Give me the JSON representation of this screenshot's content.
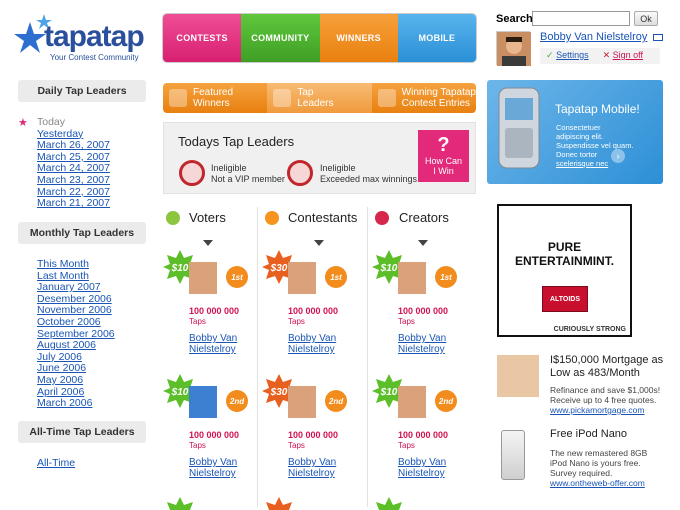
{
  "brand": {
    "name": "tapatap",
    "tagline": "Your Contest Community"
  },
  "nav": [
    {
      "label": "CONTESTS",
      "color": "#e0307f"
    },
    {
      "label": "COMMUNITY",
      "color": "#4bae2f"
    },
    {
      "label": "WINNERS",
      "color": "#f0891f"
    },
    {
      "label": "MOBILE",
      "color": "#3ea1e0"
    }
  ],
  "search": {
    "label": "Search",
    "value": "",
    "button": "Ok"
  },
  "user": {
    "name": "Bobby Van Nielstelroy",
    "settings": "Settings",
    "signout": "Sign off"
  },
  "sidebar": {
    "daily": {
      "title": "Daily Tap Leaders",
      "items": [
        "Today",
        "Yesterday",
        "March 26, 2007",
        "March 25, 2007",
        "March 24, 2007",
        "March 23, 2007",
        "March 22, 2007",
        "March 21, 2007"
      ]
    },
    "monthly": {
      "title": "Monthly Tap Leaders",
      "items": [
        "This Month",
        "Last Month",
        "January 2007",
        "Desember 2006",
        "November 2006",
        "October 2006",
        "September 2006",
        "August 2006",
        "July 2006",
        "June 2006",
        "May 2006",
        "April 2006",
        "March 2006"
      ]
    },
    "alltime": {
      "title": "All-Time Tap Leaders",
      "items": [
        "All-Time"
      ]
    }
  },
  "tabs2": [
    {
      "l1": "Featured",
      "l2": "Winners",
      "color": "#ef8b22"
    },
    {
      "l1": "Tap",
      "l2": "Leaders",
      "color": "#f5a24a"
    },
    {
      "l1": "Winning Tapatap",
      "l2": "Contest Entries",
      "color": "#ef8b22"
    }
  ],
  "todays": {
    "title": "Todays Tap Leaders",
    "inel1": {
      "a": "Ineligible",
      "b": "Not a VIP member"
    },
    "inel2": {
      "a": "Ineligible",
      "b": "Exceeded max winnings"
    },
    "how": {
      "q": "?",
      "a": "How Can",
      "b": "I Win"
    }
  },
  "columns": [
    {
      "title": "Voters",
      "icon": "#8cc63f"
    },
    {
      "title": "Contestants",
      "icon": "#f7941d"
    },
    {
      "title": "Creators",
      "icon": "#d7264b"
    }
  ],
  "entries": [
    [
      {
        "badge": "$10",
        "bc": "#5cbf2a",
        "place": "1st",
        "taps": "100 000 000",
        "unit": "Taps",
        "n1": "Bobby Van",
        "n2": "Nielstelroy"
      },
      {
        "badge": "$10",
        "bc": "#5cbf2a",
        "place": "2nd",
        "taps": "100 000 000",
        "unit": "Taps",
        "n1": "Bobby Van",
        "n2": "Nielstelroy"
      }
    ],
    [
      {
        "badge": "$30",
        "bc": "#e8601f",
        "place": "1st",
        "taps": "100 000 000",
        "unit": "Taps",
        "n1": "Bobby Van",
        "n2": "Nielstelroy"
      },
      {
        "badge": "$30",
        "bc": "#e8601f",
        "place": "2nd",
        "taps": "100 000 000",
        "unit": "Taps",
        "n1": "Bobby Van",
        "n2": "Nielstelroy"
      }
    ],
    [
      {
        "badge": "$10",
        "bc": "#5cbf2a",
        "place": "1st",
        "taps": "100 000 000",
        "unit": "Taps",
        "n1": "Bobby Van",
        "n2": "Nielstelroy"
      },
      {
        "badge": "$10",
        "bc": "#5cbf2a",
        "place": "2nd",
        "taps": "100 000 000",
        "unit": "Taps",
        "n1": "Bobby Van",
        "n2": "Nielstelroy"
      }
    ]
  ],
  "mobile": {
    "title": "Tapatap Mobile!",
    "text": "Consectetuer adipiscing elit. Suspendisse vel quam. Donec tortor",
    "link": "scelerisque nec"
  },
  "ad": {
    "l1": "PURE",
    "l2": "ENTERTAINMINT.",
    "brand": "ALTOIDS",
    "foot": "CURIOUSLY STRONG"
  },
  "promos": [
    {
      "title": "I$150,000 Mortgage as Low as 483/Month",
      "desc": "Refinance and save $1,000s! Receive up to 4 free quotes.",
      "url": "www.pickamortgage.com"
    },
    {
      "title": "Free iPod Nano",
      "desc": "The new remastered 8GB iPod Nano is yours free. Survey required.",
      "url": "www.ontheweb-offer.com"
    }
  ]
}
